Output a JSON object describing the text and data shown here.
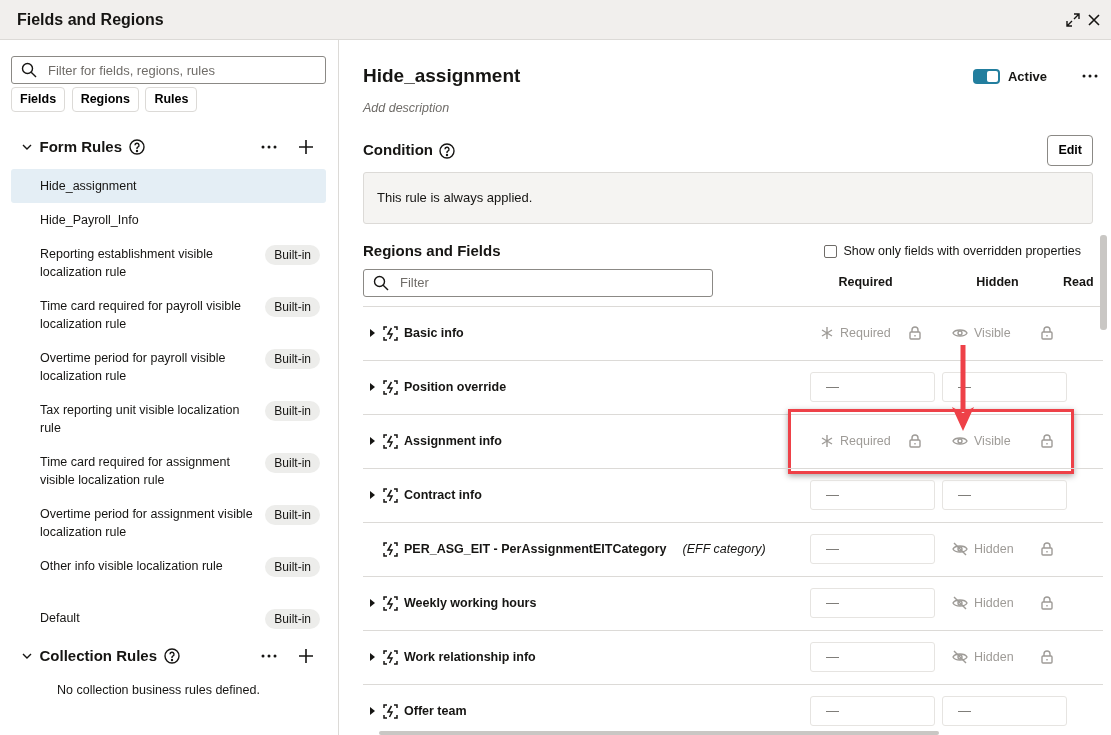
{
  "window": {
    "title": "Fields and Regions"
  },
  "sidebar": {
    "search": {
      "placeholder": "Filter for fields, regions, rules"
    },
    "chips": [
      {
        "label": "Fields"
      },
      {
        "label": "Regions"
      },
      {
        "label": "Rules"
      }
    ],
    "sections": [
      {
        "title": "Form Rules",
        "expanded": true,
        "items": [
          {
            "label": "Hide_assignment",
            "selected": true
          },
          {
            "label": "Hide_Payroll_Info",
            "selected": false
          },
          {
            "label": "Reporting establishment visible localization rule",
            "selected": false,
            "badge": "Built-in"
          },
          {
            "label": "Time card required for payroll visible localization rule",
            "selected": false,
            "badge": "Built-in"
          },
          {
            "label": "Overtime period for payroll visible localization rule",
            "selected": false,
            "badge": "Built-in"
          },
          {
            "label": "Tax reporting unit visible localization rule",
            "selected": false,
            "badge": "Built-in"
          },
          {
            "label": "Time card required for assignment visible localization rule",
            "selected": false,
            "badge": "Built-in"
          },
          {
            "label": "Overtime period for assignment visible localization rule",
            "selected": false,
            "badge": "Built-in"
          },
          {
            "label": "Other info visible localization rule",
            "selected": false,
            "badge": "Built-in"
          },
          {
            "label": "Default",
            "selected": false,
            "badge": "Built-in"
          }
        ]
      },
      {
        "title": "Collection Rules",
        "expanded": true,
        "empty_text": "No collection business rules defined."
      }
    ]
  },
  "rule": {
    "title": "Hide_assignment",
    "active": {
      "label": "Active",
      "on": true
    },
    "description": "Add description",
    "condition": {
      "title": "Condition",
      "button": "Edit",
      "text": "This rule is always applied."
    },
    "regions": {
      "title": "Regions and Fields",
      "filter_toggle": {
        "label": "Show only fields with overridden properties",
        "checked": false
      },
      "filter": {
        "placeholder": "Filter"
      },
      "columns": [
        "Required",
        "Hidden",
        "Read"
      ],
      "rows": [
        {
          "name": "Basic info",
          "expandable": true,
          "highlighted": false,
          "cells": [
            {
              "kind": "required",
              "text": "Required"
            },
            {
              "kind": "visible",
              "text": "Visible"
            }
          ]
        },
        {
          "name": "Position override",
          "expandable": true,
          "highlighted": false,
          "cells": [
            {
              "kind": "empty",
              "text": "—"
            },
            {
              "kind": "empty",
              "text": "—"
            }
          ]
        },
        {
          "name": "Assignment info",
          "expandable": true,
          "highlighted": true,
          "cells": [
            {
              "kind": "required",
              "text": "Required"
            },
            {
              "kind": "visible",
              "text": "Visible"
            }
          ]
        },
        {
          "name": "Contract info",
          "expandable": true,
          "highlighted": false,
          "cells": [
            {
              "kind": "empty",
              "text": "—"
            },
            {
              "kind": "empty",
              "text": "—"
            }
          ]
        },
        {
          "name": "PER_ASG_EIT - PerAssignmentEITCategory",
          "note": "(EFF category)",
          "expandable": false,
          "highlighted": false,
          "cells": [
            {
              "kind": "empty",
              "text": "—"
            },
            {
              "kind": "hidden",
              "text": "Hidden"
            }
          ]
        },
        {
          "name": "Weekly working hours",
          "expandable": true,
          "highlighted": false,
          "cells": [
            {
              "kind": "empty",
              "text": "—"
            },
            {
              "kind": "hidden",
              "text": "Hidden"
            }
          ]
        },
        {
          "name": "Work relationship info",
          "expandable": true,
          "highlighted": false,
          "cells": [
            {
              "kind": "empty",
              "text": "—"
            },
            {
              "kind": "hidden",
              "text": "Hidden"
            }
          ]
        },
        {
          "name": "Offer team",
          "expandable": true,
          "highlighted": false,
          "cells": [
            {
              "kind": "empty",
              "text": "—"
            },
            {
              "kind": "empty",
              "text": "—"
            }
          ]
        }
      ]
    }
  }
}
